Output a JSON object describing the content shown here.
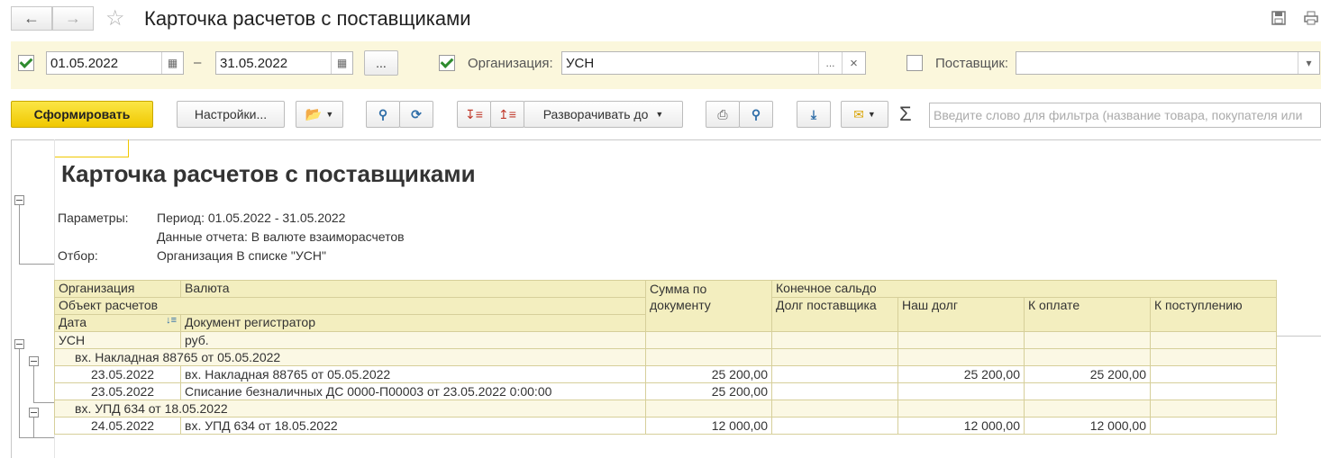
{
  "window": {
    "title": "Карточка расчетов с поставщиками",
    "back_icon": "arrow-left-icon",
    "forward_icon": "arrow-right-icon",
    "favorite_icon": "star-icon",
    "save_icon": "save-icon",
    "print_icon": "print-icon"
  },
  "filters": {
    "period_enabled": true,
    "date_from": "01.05.2022",
    "date_sep": "–",
    "date_to": "31.05.2022",
    "period_select_label": "...",
    "organization_enabled": true,
    "organization_label": "Организация:",
    "organization_value": "УСН",
    "organization_select": "...",
    "organization_clear": "×",
    "supplier_enabled": false,
    "supplier_label": "Поставщик:",
    "supplier_value": ""
  },
  "toolbar": {
    "generate_label": "Сформировать",
    "settings_label": "Настройки...",
    "expand_label": "Разворачивать до",
    "sum_symbol": "Σ",
    "search_placeholder": "Введите слово для фильтра (название товара, покупателя или"
  },
  "report": {
    "title": "Карточка расчетов с поставщиками",
    "params_label": "Параметры:",
    "period_line": "Период: 01.05.2022 - 31.05.2022",
    "data_line": "Данные отчета: В валюте взаиморасчетов",
    "filter_label": "Отбор:",
    "filter_line": "Организация В списке \"УСН\"",
    "headers": {
      "organization": "Организация",
      "currency": "Валюта",
      "object": "Объект расчетов",
      "date": "Дата",
      "document": "Документ регистратор",
      "amount": "Сумма по документу",
      "end_balance": "Конечное сальдо",
      "supplier_debt": "Долг поставщика",
      "our_debt": "Наш долг",
      "to_pay": "К оплате",
      "to_receive": "К поступлению"
    },
    "rows": [
      {
        "c0": "УСН",
        "c1": "руб.",
        "amount": "",
        "supplier_debt": "",
        "our_debt": "",
        "to_pay": "",
        "to_receive": ""
      },
      {
        "c0": "вх. Накладная 88765 от 05.05.2022",
        "c1": "",
        "amount": "",
        "supplier_debt": "",
        "our_debt": "",
        "to_pay": "",
        "to_receive": ""
      },
      {
        "c0": "23.05.2022",
        "c1": "вх. Накладная 88765 от 05.05.2022",
        "amount": "25 200,00",
        "supplier_debt": "",
        "our_debt": "25 200,00",
        "to_pay": "25 200,00",
        "to_receive": ""
      },
      {
        "c0": "23.05.2022",
        "c1": "Списание безналичных ДС 0000-П00003 от 23.05.2022 0:00:00",
        "amount": "25 200,00",
        "supplier_debt": "",
        "our_debt": "",
        "to_pay": "",
        "to_receive": ""
      },
      {
        "c0": "вх. УПД 634 от 18.05.2022",
        "c1": "",
        "amount": "",
        "supplier_debt": "",
        "our_debt": "",
        "to_pay": "",
        "to_receive": ""
      },
      {
        "c0": "24.05.2022",
        "c1": "вх. УПД 634 от 18.05.2022",
        "amount": "12 000,00",
        "supplier_debt": "",
        "our_debt": "12 000,00",
        "to_pay": "12 000,00",
        "to_receive": ""
      }
    ]
  }
}
